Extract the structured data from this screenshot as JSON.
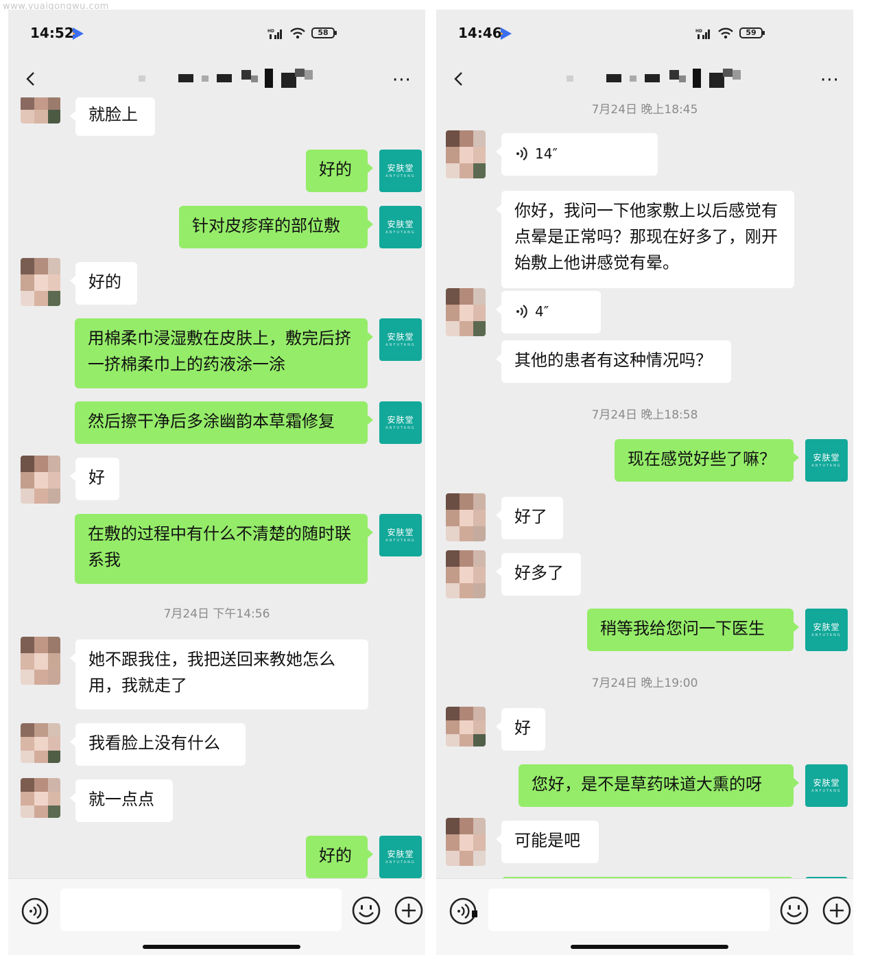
{
  "watermark": "www.yuaigongwu.com",
  "brand_logo": {
    "text": "安肤堂",
    "subtext": "ANFUTANG",
    "color": "#12a89a"
  },
  "colors": {
    "out_bubble": "#95ec69",
    "in_bubble": "#ffffff",
    "background": "#ededed"
  },
  "left": {
    "status": {
      "time": "14:52",
      "battery": "58",
      "network": "HD"
    },
    "messages": [
      {
        "dir": "in",
        "text": "就脸上"
      },
      {
        "dir": "out",
        "text": "好的"
      },
      {
        "dir": "out",
        "text": "针对皮疹痒的部位敷"
      },
      {
        "dir": "in",
        "text": "好的"
      },
      {
        "dir": "out",
        "text": "用棉柔巾浸湿敷在皮肤上，敷完后挤一挤棉柔巾上的药液涂一涂"
      },
      {
        "dir": "out",
        "text": "然后擦干净后多涂幽韵本草霜修复"
      },
      {
        "dir": "in",
        "text": "好"
      },
      {
        "dir": "out",
        "text": "在敷的过程中有什么不清楚的随时联系我"
      },
      {
        "dir": "time",
        "text": "7月24日 下午14:56"
      },
      {
        "dir": "in",
        "text": "她不跟我住，我把送回来教她怎么用，我就走了"
      },
      {
        "dir": "in",
        "text": "我看脸上没有什么"
      },
      {
        "dir": "in",
        "text": "就一点点"
      },
      {
        "dir": "out",
        "text": "好的"
      }
    ]
  },
  "right": {
    "status": {
      "time": "14:46",
      "battery": "59",
      "network": "HD"
    },
    "messages": [
      {
        "dir": "time",
        "text": "7月24日 晚上18:45"
      },
      {
        "dir": "voice",
        "text": "14″"
      },
      {
        "dir": "in",
        "text": "你好，我问一下他家敷上以后感觉有点晕是正常吗？那现在好多了，刚开始敷上他讲感觉有晕。"
      },
      {
        "dir": "voice",
        "text": "4″"
      },
      {
        "dir": "in",
        "text": "其他的患者有这种情况吗？"
      },
      {
        "dir": "time",
        "text": "7月24日 晚上18:58"
      },
      {
        "dir": "out",
        "text": "现在感觉好些了嘛？"
      },
      {
        "dir": "in",
        "text": "好了"
      },
      {
        "dir": "in",
        "text": "好多了"
      },
      {
        "dir": "out",
        "text": "稍等我给您问一下医生"
      },
      {
        "dir": "time",
        "text": "7月24日 晚上19:00"
      },
      {
        "dir": "in",
        "text": "好"
      },
      {
        "dir": "out",
        "text": "您好，是不是草药味道大熏的呀"
      },
      {
        "dir": "in",
        "text": "可能是吧"
      }
    ]
  }
}
